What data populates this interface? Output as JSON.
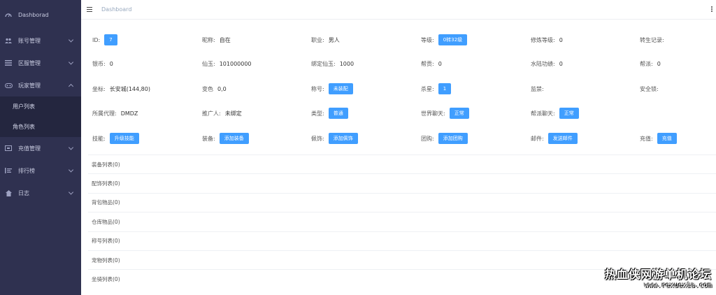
{
  "sidebar": {
    "items": [
      {
        "label": "Dashborad",
        "icon": "dashboard-icon",
        "arrow": false
      },
      {
        "label": "账号管理",
        "icon": "account-icon",
        "arrow": true
      },
      {
        "label": "区服管理",
        "icon": "server-list-icon",
        "arrow": true
      },
      {
        "label": "玩家管理",
        "icon": "player-icon",
        "arrow": true,
        "expanded": true,
        "children": [
          {
            "label": "用户列表"
          },
          {
            "label": "角色列表"
          }
        ]
      },
      {
        "label": "充值管理",
        "icon": "recharge-icon",
        "arrow": true
      },
      {
        "label": "排行榜",
        "icon": "ranking-icon",
        "arrow": true
      },
      {
        "label": "日志",
        "icon": "log-icon",
        "arrow": true
      }
    ]
  },
  "header": {
    "breadcrumb": "Dashboard"
  },
  "rows": [
    [
      {
        "label": "ID:",
        "badge": "7"
      },
      {
        "label": "昵称:",
        "value": "自在"
      },
      {
        "label": "职业:",
        "value": "男人"
      },
      {
        "label": "等级:",
        "badge": "0转32级"
      },
      {
        "label": "修炼等级:",
        "value": "0"
      },
      {
        "label": "转生记录:",
        "value": ""
      }
    ],
    [
      {
        "label": "银币:",
        "value": "0"
      },
      {
        "label": "仙玉:",
        "value": "101000000"
      },
      {
        "label": "绑定仙玉:",
        "value": "1000"
      },
      {
        "label": "帮贡:",
        "value": "0"
      },
      {
        "label": "水陆功绩:",
        "value": "0"
      },
      {
        "label": "帮派:",
        "value": "0"
      }
    ],
    [
      {
        "label": "坐标:",
        "value": "长安城(144,80)"
      },
      {
        "label": "变色",
        "value": "0,0"
      },
      {
        "label": "称号:",
        "badge": "未装配"
      },
      {
        "label": "杀星:",
        "badge": "1"
      },
      {
        "label": "监禁:",
        "value": ""
      },
      {
        "label": "安全锁:",
        "value": ""
      }
    ],
    [
      {
        "label": "所属代理:",
        "value": "DMDZ"
      },
      {
        "label": "推广人:",
        "value": "未绑定"
      },
      {
        "label": "类型:",
        "badge": "普通"
      },
      {
        "label": "世界聊天:",
        "badge": "正常"
      },
      {
        "label": "帮派聊天:",
        "badge": "正常"
      }
    ],
    [
      {
        "label": "技能:",
        "badge": "升级技能"
      },
      {
        "label": "装备:",
        "badge": "添加装备"
      },
      {
        "label": "佩饰:",
        "badge": "添加佩饰"
      },
      {
        "label": "团购:",
        "badge": "添加团购"
      },
      {
        "label": "邮件:",
        "badge": "发送邮件"
      },
      {
        "label": "充值:",
        "badge": "充值"
      }
    ]
  ],
  "lists": [
    "装备列表(0)",
    "配饰列表(0)",
    "背包物品(0)",
    "仓库物品(0)",
    "称号列表(0)",
    "宠物列表(0)",
    "坐骑列表(0)"
  ],
  "watermark": {
    "title": "热血侠网游单机论坛",
    "url": "www.rexuexia.com"
  },
  "colors": {
    "sidebar_bg": "#2f3150",
    "submenu_bg": "#24263f",
    "button": "#409eff"
  }
}
